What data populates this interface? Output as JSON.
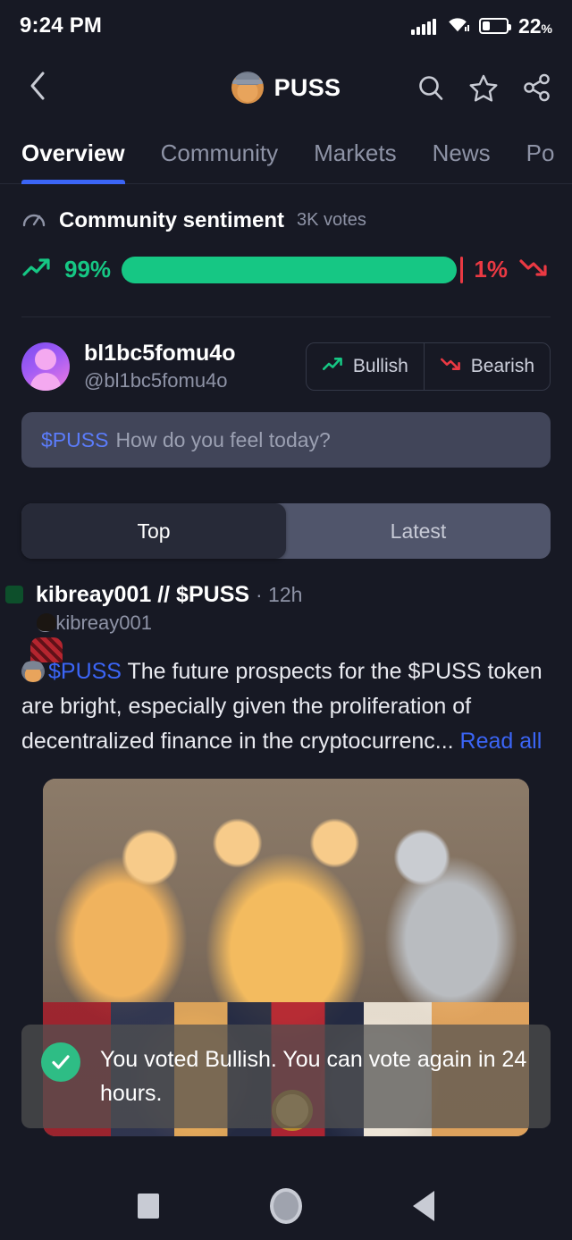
{
  "status_bar": {
    "time": "9:24 PM",
    "battery_percent": "22",
    "percent_symbol": "%",
    "signal_icon": "cellular-signal-icon",
    "wifi_icon": "wifi-icon",
    "battery_icon": "battery-icon"
  },
  "header": {
    "back_icon": "back-chevron-icon",
    "logo_icon": "puss-coin-logo-icon",
    "title": "PUSS",
    "search_icon": "search-icon",
    "star_icon": "star-icon",
    "share_icon": "share-icon"
  },
  "tabs": [
    {
      "label": "Overview",
      "active": true
    },
    {
      "label": "Community",
      "active": false
    },
    {
      "label": "Markets",
      "active": false
    },
    {
      "label": "News",
      "active": false
    },
    {
      "label": "Po",
      "active": false
    }
  ],
  "sentiment": {
    "gauge_icon": "speedometer-icon",
    "title": "Community sentiment",
    "votes": "3K votes",
    "bullish_percent_label": "99%",
    "bearish_percent_label": "1%",
    "bullish_value": 99,
    "bearish_value": 1,
    "bullish_icon": "trend-up-icon",
    "bearish_icon": "trend-down-icon",
    "bullish_color": "#16c784",
    "bearish_color": "#ea3943"
  },
  "compose": {
    "avatar_icon": "user-avatar",
    "name": "bl1bc5fomu4o",
    "handle": "@bl1bc5fomu4o",
    "bullish_button": "Bullish",
    "bearish_button": "Bearish",
    "bullish_icon": "trend-up-icon",
    "bearish_icon": "trend-down-icon",
    "input_ticker": "$PUSS",
    "input_placeholder": "How do you feel today?"
  },
  "feed_filter": {
    "options": [
      {
        "label": "Top",
        "selected": true
      },
      {
        "label": "Latest",
        "selected": false
      }
    ]
  },
  "post": {
    "avatar_icon": "user-photo-avatar",
    "author": "kibreay001 // $PUSS",
    "timestamp": "· 12h",
    "handle": "@kibreay001",
    "emoji_icon": "cat-emoji-icon",
    "cashtag": "$PUSS",
    "body": "The future prospects for the $PUSS token are bright, especially given the proliferation of decentralized finance in the cryptocurrenc...",
    "read_all": "Read all",
    "media_alt": "anime-style cats in ornate robes"
  },
  "toast": {
    "check_icon": "check-circle-icon",
    "message": "You voted Bullish. You can vote again in 24 hours."
  },
  "nav_bar": {
    "recents_icon": "square-recents-icon",
    "home_icon": "circle-home-icon",
    "back_icon": "triangle-back-icon"
  },
  "colors": {
    "background": "#171924",
    "accent_blue": "#3b65f6",
    "green": "#16c784",
    "red": "#ea3943"
  }
}
